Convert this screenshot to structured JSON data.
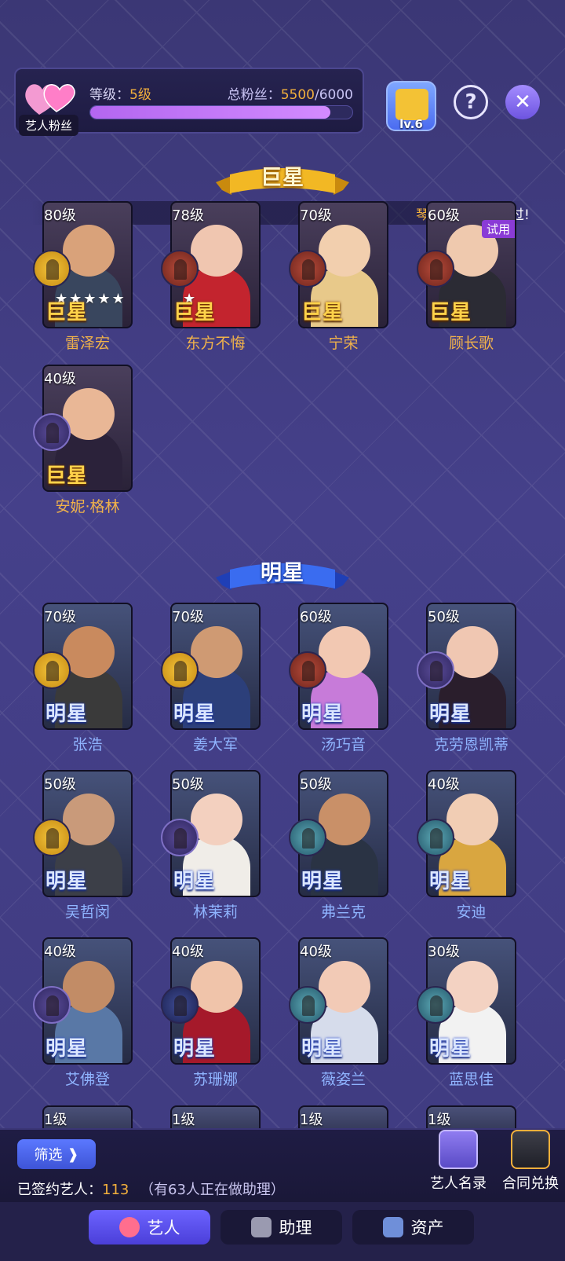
{
  "header": {
    "fan_tag": "艺人粉丝",
    "level_label": "等级：",
    "level_value": "5级",
    "fans_label": "总粉丝：",
    "fans_current": "5500",
    "fans_max": "/6000",
    "fans_progress": 0.9167,
    "clapper_level": "lv.6",
    "help_glyph": "?",
    "close_glyph": "✕"
  },
  "notice": {
    "part1": "琴仙",
    "part2": "影业通过!"
  },
  "sections": {
    "superstar": "巨星",
    "star": "明星"
  },
  "superstars": [
    {
      "level": "80级",
      "name": "雷泽宏",
      "tier": "巨星",
      "badge": "gold",
      "stars": "★★★★★",
      "skin": "#d9a27a",
      "outfit": "#39465e"
    },
    {
      "level": "78级",
      "name": "东方不悔",
      "tier": "巨星",
      "badge": "red",
      "stars": "★",
      "skin": "#f0c6b0",
      "outfit": "#c3242e"
    },
    {
      "level": "70级",
      "name": "宁荣",
      "tier": "巨星",
      "badge": "red",
      "stars": "",
      "skin": "#f2cfae",
      "outfit": "#e8c98a"
    },
    {
      "level": "60级",
      "name": "顾长歌",
      "tier": "巨星",
      "badge": "red",
      "stars": "",
      "skin": "#efc9ae",
      "outfit": "#2b2b34",
      "trial": "试用"
    },
    {
      "level": "40级",
      "name": "安妮·格林",
      "tier": "巨星",
      "badge": "purple",
      "stars": "",
      "skin": "#e9b796",
      "outfit": "#2b223a"
    }
  ],
  "stars": [
    {
      "level": "70级",
      "name": "张浩",
      "tier": "明星",
      "badge": "gold",
      "skin": "#c98a5e",
      "outfit": "#3a3a3a"
    },
    {
      "level": "70级",
      "name": "姜大军",
      "tier": "明星",
      "badge": "gold",
      "skin": "#cf9a73",
      "outfit": "#2c3f7a"
    },
    {
      "level": "60级",
      "name": "汤巧音",
      "tier": "明星",
      "badge": "red",
      "skin": "#f2c8b2",
      "outfit": "#c77bd9"
    },
    {
      "level": "50级",
      "name": "克劳恩凯蒂",
      "tier": "明星",
      "badge": "purple",
      "skin": "#f0c7b2",
      "outfit": "#2a1e2c"
    },
    {
      "level": "50级",
      "name": "吴哲闵",
      "tier": "明星",
      "badge": "gold",
      "skin": "#c99a7a",
      "outfit": "#3c3f48"
    },
    {
      "level": "50级",
      "name": "林茉莉",
      "tier": "明星",
      "badge": "purple",
      "skin": "#f3d0bf",
      "outfit": "#f0ede8"
    },
    {
      "level": "50级",
      "name": "弗兰克",
      "tier": "明星",
      "badge": "teal",
      "skin": "#c99068",
      "outfit": "#2a3344"
    },
    {
      "level": "40级",
      "name": "安迪",
      "tier": "明星",
      "badge": "teal",
      "skin": "#f1cdb4",
      "outfit": "#d9a640"
    },
    {
      "level": "40级",
      "name": "艾佛登",
      "tier": "明星",
      "badge": "purple",
      "skin": "#c28c66",
      "outfit": "#5978a6"
    },
    {
      "level": "40级",
      "name": "苏珊娜",
      "tier": "明星",
      "badge": "navy",
      "skin": "#f0c4aa",
      "outfit": "#a5192a"
    },
    {
      "level": "40级",
      "name": "薇姿兰",
      "tier": "明星",
      "badge": "teal",
      "skin": "#f2cab6",
      "outfit": "#d6dceb"
    },
    {
      "level": "30级",
      "name": "蓝思佳",
      "tier": "明星",
      "badge": "teal",
      "skin": "#f3d2c2",
      "outfit": "#f2f2f2"
    }
  ],
  "partial_row": [
    "1级",
    "1级",
    "1级",
    "1级"
  ],
  "bottom": {
    "filter": "筛选",
    "filter_arrow": "❱",
    "signed_label": "已签约艺人：",
    "signed_count": "113",
    "helping_text": "（有63人正在做助理）",
    "roster": "艺人名录",
    "contract": "合同兑换"
  },
  "tabs": [
    "艺人",
    "助理",
    "资产"
  ]
}
